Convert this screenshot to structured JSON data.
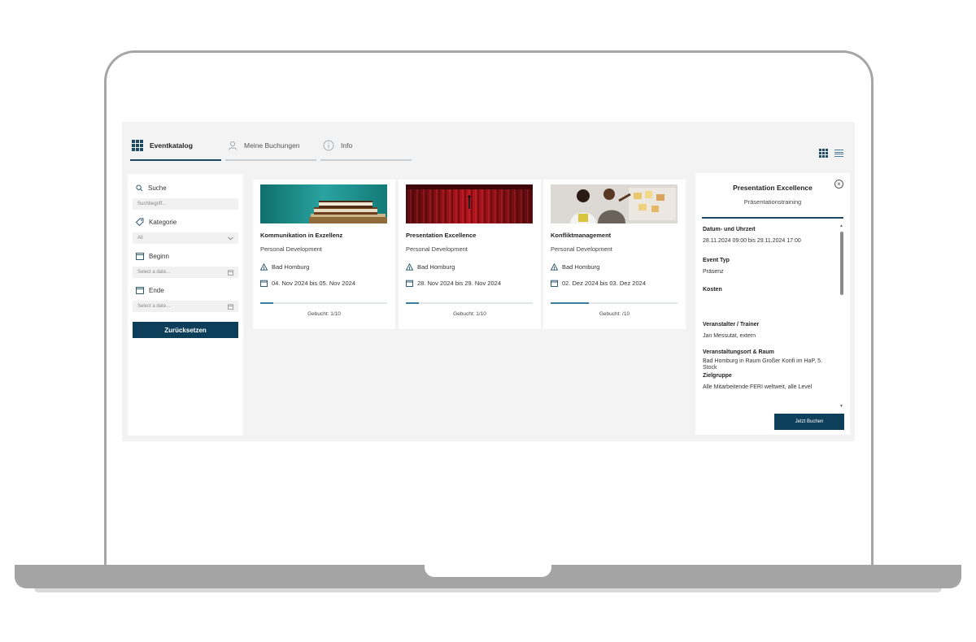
{
  "tabs": [
    {
      "label": "Eventkatalog",
      "icon": "grid-icon",
      "active": true
    },
    {
      "label": "Meine Buchungen",
      "icon": "user-icon",
      "active": false
    },
    {
      "label": "Info",
      "icon": "info-icon",
      "active": false
    }
  ],
  "filters": {
    "search_label": "Suche",
    "search_placeholder": "Suchbegriff...",
    "category_label": "Kategorie",
    "category_value": "All",
    "start_label": "Beginn",
    "start_placeholder": "Select a date...",
    "end_label": "Ende",
    "end_placeholder": "Select a date...",
    "reset_label": "Zurücksetzen"
  },
  "events": [
    {
      "title": "Kommunikation in Exzellenz",
      "category": "Personal Development",
      "location": "Bad Homburg",
      "dates": "04. Nov 2024 bis 05. Nov 2024",
      "booked": "Gebucht: 1/10",
      "booked_fraction": 0.1,
      "image": "books"
    },
    {
      "title": "Presentation Excellence",
      "category": "Personal Development",
      "location": "Bad Homburg",
      "dates": "28. Nov 2024 bis 29. Nov 2024",
      "booked": "Gebucht: 1/10",
      "booked_fraction": 0.1,
      "image": "stage-curtain"
    },
    {
      "title": "Konfliktmanagement",
      "category": "Personal Development",
      "location": "Bad Homburg",
      "dates": "02. Dez 2024 bis 03. Dez 2024",
      "booked": "Gebucht: /10",
      "booked_fraction": 0.3,
      "image": "people-whiteboard"
    }
  ],
  "detail": {
    "title": "Presentation Excellence",
    "subtitle": "Präsentationstraining",
    "datetime_label": "Datum- und Uhrzeit",
    "datetime_value": "28.11.2024 09:00 bis 29.11.2024 17:00",
    "type_label": "Event Typ",
    "type_value": "Präsenz",
    "cost_label": "Kosten",
    "cost_value": "",
    "trainer_label": "Veranstalter / Trainer",
    "trainer_value": "Jan Messutat, extern",
    "venue_label": "Veranstaltungsort & Raum",
    "venue_value": "Bad Homburg in Raum Großer Konfi im HaP, 5. Stock",
    "audience_label": "Zielgruppe",
    "audience_value": "Alle Mitarbeitende FERI weltweit, alle Level",
    "book_label": "Jetzt Buchen"
  },
  "colors": {
    "primary": "#0e3f5a",
    "accent": "#3a7f9d",
    "background": "#f3f3f3"
  }
}
